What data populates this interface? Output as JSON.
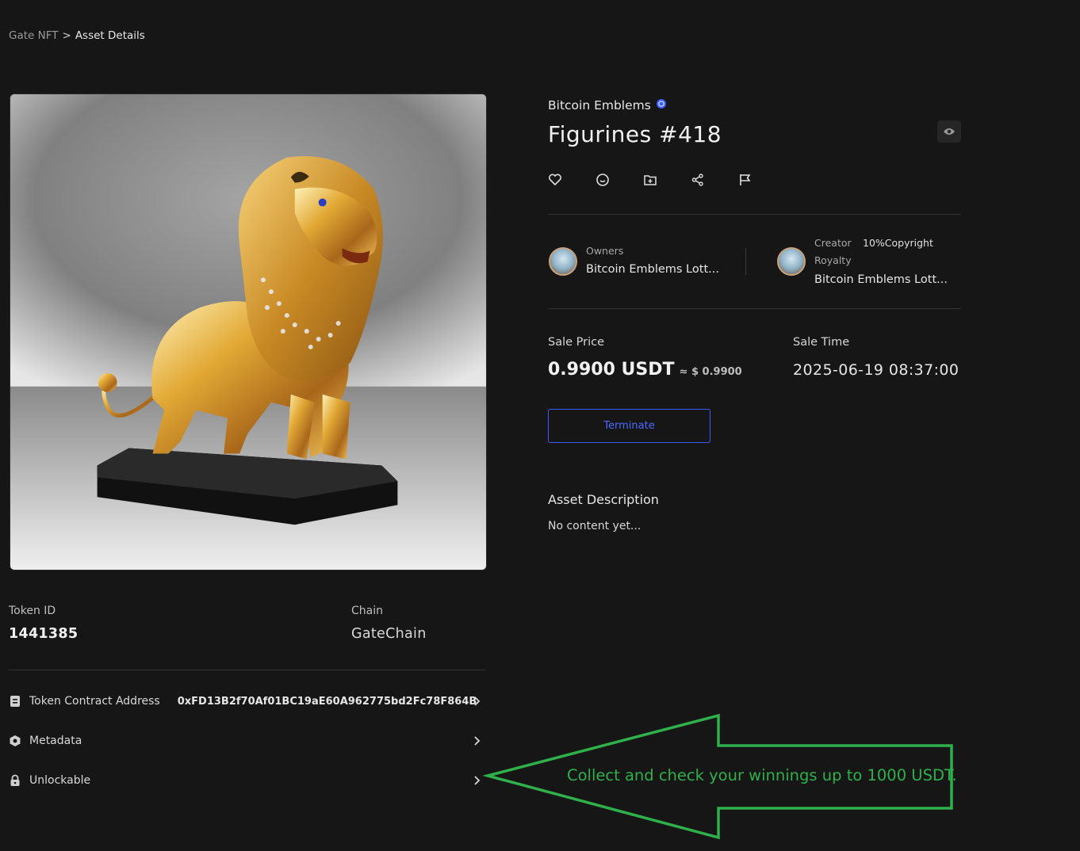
{
  "breadcrumb": {
    "root": "Gate NFT",
    "separator": ">",
    "current": "Asset Details"
  },
  "asset": {
    "collection": "Bitcoin Emblems",
    "title": "Figurines #418",
    "image_alt": "Gold lion figurine on a black base"
  },
  "token": {
    "id_label": "Token ID",
    "id_value": "1441385",
    "chain_label": "Chain",
    "chain_value": "GateChain"
  },
  "details": {
    "contract_label": "Token Contract Address",
    "contract_value": "0xFD13B2f70Af01BC19aE60A962775bd2Fc78F864B",
    "metadata_label": "Metadata",
    "unlockable_label": "Unlockable"
  },
  "people": {
    "owners_label": "Owners",
    "owner_name": "Bitcoin Emblems Lott...",
    "creator_label": "Creator",
    "royalty_value": "10%Copyright",
    "royalty_label": "Royalty",
    "creator_name": "Bitcoin Emblems Lott..."
  },
  "sale": {
    "price_label": "Sale Price",
    "price_value": "0.9900 USDT",
    "price_usd": "≈ $ 0.9900",
    "time_label": "Sale Time",
    "time_value": "2025-06-19 08:37:00",
    "terminate_label": "Terminate"
  },
  "description": {
    "title": "Asset Description",
    "body": "No content yet..."
  },
  "overlay": {
    "message": "Collect and check your winnings up to 1000 USDT."
  },
  "colors": {
    "background": "#161616",
    "accent_blue": "#3d5afe",
    "overlay_green": "#2fb04a"
  },
  "icons": [
    "verified-icon",
    "eye-icon",
    "heart-icon",
    "comment-icon",
    "add-folder-icon",
    "share-icon",
    "flag-icon",
    "contract-icon",
    "metadata-icon",
    "lock-icon",
    "chevron-right-icon"
  ]
}
